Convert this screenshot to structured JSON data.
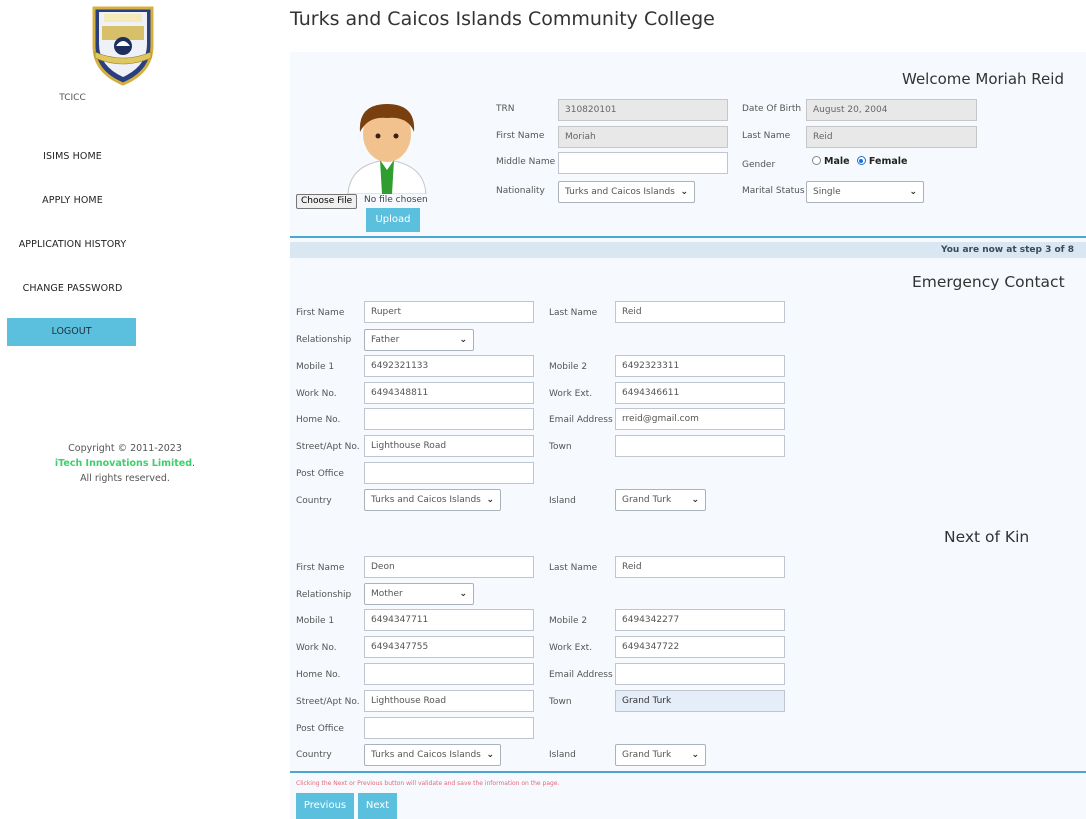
{
  "sidebar": {
    "logo_caption": "TCICC",
    "nav": [
      "ISIMS HOME",
      "APPLY HOME",
      "APPLICATION HISTORY",
      "CHANGE PASSWORD"
    ],
    "logout": "LOGOUT",
    "copyright_line": "Copyright © 2011-2023",
    "brand": "iTech Innovations Limited",
    "rights": "All rights reserved."
  },
  "page_title": "Turks and Caicos Islands Community College",
  "profile": {
    "welcome": "Welcome Moriah Reid",
    "choose_file": "Choose File",
    "file_status": "No file chosen",
    "upload": "Upload",
    "trn_label": "TRN",
    "trn": "310820101",
    "dob_label": "Date Of Birth",
    "dob": "August 20, 2004",
    "first_name_label": "First Name",
    "first_name": "Moriah",
    "last_name_label": "Last Name",
    "last_name": "Reid",
    "middle_name_label": "Middle Name",
    "middle_name": "",
    "gender_label": "Gender",
    "gender_male": "Male",
    "gender_female": "Female",
    "gender_selected": "Female",
    "nationality_label": "Nationality",
    "nationality": "Turks and Caicos Islands",
    "marital_label": "Marital Status",
    "marital": "Single"
  },
  "step_text": "You are now at step 3 of 8",
  "emergency": {
    "heading": "Emergency Contact",
    "labels": {
      "first_name": "First Name",
      "last_name": "Last Name",
      "relationship": "Relationship",
      "mobile1": "Mobile 1",
      "mobile2": "Mobile 2",
      "work_no": "Work No.",
      "work_ext": "Work Ext.",
      "home_no": "Home No.",
      "email": "Email Address",
      "street": "Street/Apt No.",
      "town": "Town",
      "post_office": "Post Office",
      "country": "Country",
      "island": "Island"
    },
    "values": {
      "first_name": "Rupert",
      "last_name": "Reid",
      "relationship": "Father",
      "mobile1": "6492321133",
      "mobile2": "6492323311",
      "work_no": "6494348811",
      "work_ext": "6494346611",
      "home_no": "",
      "email": "rreid@gmail.com",
      "street": "Lighthouse Road",
      "town": "",
      "post_office": "",
      "country": "Turks and Caicos Islands",
      "island": "Grand Turk"
    }
  },
  "next_of_kin": {
    "heading": "Next of Kin",
    "labels": {
      "first_name": "First Name",
      "last_name": "Last Name",
      "relationship": "Relationship",
      "mobile1": "Mobile 1",
      "mobile2": "Mobile 2",
      "work_no": "Work No.",
      "work_ext": "Work Ext.",
      "home_no": "Home No.",
      "email": "Email Address",
      "street": "Street/Apt No.",
      "town": "Town",
      "post_office": "Post Office",
      "country": "Country",
      "island": "Island"
    },
    "values": {
      "first_name": "Deon",
      "last_name": "Reid",
      "relationship": "Mother",
      "mobile1": "6494347711",
      "mobile2": "6494342277",
      "work_no": "6494347755",
      "work_ext": "6494347722",
      "home_no": "",
      "email": "",
      "street": "Lighthouse Road",
      "town": "Grand Turk",
      "post_office": "",
      "country": "Turks and Caicos Islands",
      "island": "Grand Turk"
    }
  },
  "footer": {
    "note": "Clicking the Next or Previous button will validate and save the information on the page.",
    "previous": "Previous",
    "next": "Next"
  },
  "colors": {
    "accent": "#5bc0de",
    "rule": "#4ba7cf",
    "brand_green": "#3ccf6e",
    "step_bar": "#d8e7f2",
    "panel_bg": "#f6f9fd"
  }
}
